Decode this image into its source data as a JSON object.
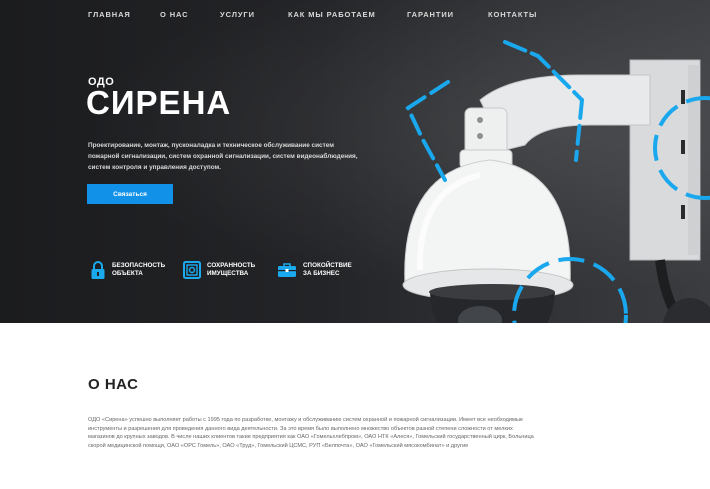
{
  "nav": {
    "items": [
      "ГЛАВНАЯ",
      "О НАС",
      "УСЛУГИ",
      "КАК МЫ РАБОТАЕМ",
      "ГАРАНТИИ",
      "КОНТАКТЫ"
    ]
  },
  "hero": {
    "company_form": "ОДО",
    "company_name": "СИРЕНА",
    "description": "Проектирование, монтаж, пусконаладка и техническое обслуживание систем пожарной сигнализации, систем охранной сигнализации, систем видеонаблюдения, систем контроля и управления доступом.",
    "cta_label": "Связаться"
  },
  "features": [
    {
      "line1": "БЕЗОПАСНОСТЬ",
      "line2": "ОБЪЕКТА",
      "icon": "lock-icon"
    },
    {
      "line1": "СОХРАННОСТЬ",
      "line2": "ИМУЩЕСТВА",
      "icon": "safe-icon"
    },
    {
      "line1": "СПОКОЙСТВИЕ",
      "line2": "ЗА БИЗНЕС",
      "icon": "briefcase-icon"
    }
  ],
  "about": {
    "title": "О НАС",
    "text": "ОДО «Сирена» успешно выполняет работы с 1995 года по разработке, монтажу и обслуживанию систем охранной и пожарной сигнализации. Имеет все необходимые инструменты и разрешения для проведения данного вида деятельности. За это время было выполнено множество объектов разной степени сложности от мелких магазинов до крупных заводов. В числе наших клиентов такие предприятия как ОАО «Гомельхлебпром», ОАО НТК «Алеся», Гомельский государственный цирк, Больница скорой медицинской помощи, ОАО «ОРС Гомель», ОАО «Труд», Гомельский ЦСМС, РУП «Белпочта», ОАО «Гомельский мясокомбинат» и другие"
  },
  "colors": {
    "accent": "#1191e8",
    "neon": "#19a8ee",
    "hero_bg": "#1f2022"
  }
}
